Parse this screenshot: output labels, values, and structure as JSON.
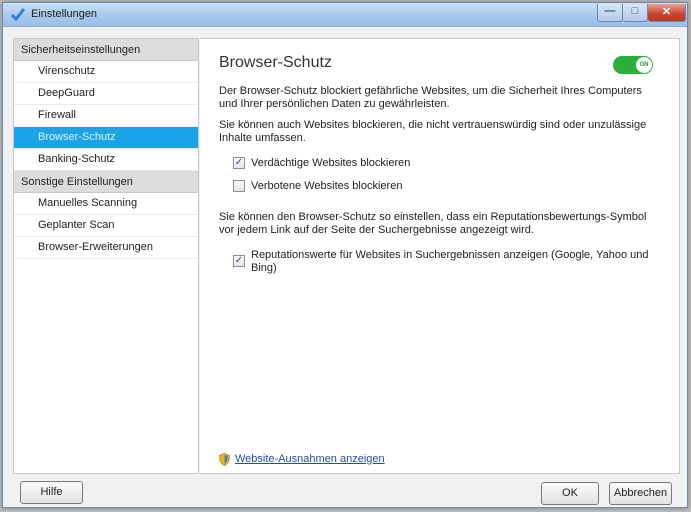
{
  "window": {
    "title": "Einstellungen",
    "controls": {
      "minimize": "—",
      "maximize": "□",
      "close": "✕"
    }
  },
  "sidebar": {
    "sections": [
      {
        "header": "Sicherheitseinstellungen",
        "items": [
          {
            "label": "Virenschutz",
            "selected": false
          },
          {
            "label": "DeepGuard",
            "selected": false
          },
          {
            "label": "Firewall",
            "selected": false
          },
          {
            "label": "Browser-Schutz",
            "selected": true
          },
          {
            "label": "Banking-Schutz",
            "selected": false
          }
        ]
      },
      {
        "header": "Sonstige Einstellungen",
        "items": [
          {
            "label": "Manuelles Scanning",
            "selected": false
          },
          {
            "label": "Geplanter Scan",
            "selected": false
          },
          {
            "label": "Browser-Erweiterungen",
            "selected": false
          }
        ]
      }
    ]
  },
  "main": {
    "title": "Browser-Schutz",
    "toggle": {
      "label": "ON",
      "state": "on",
      "color": "#2cae3b"
    },
    "intro": "Der Browser-Schutz blockiert gefährliche Websites, um die Sicherheit Ihres Computers und Ihrer persönlichen Daten zu gewährleisten.",
    "block_text": "Sie können auch Websites blockieren, die nicht vertrauenswürdig sind oder unzulässige Inhalte umfassen.",
    "options": [
      {
        "label": "Verdächtige Websites blockieren",
        "checked": true
      },
      {
        "label": "Verbotene Websites blockieren",
        "checked": false
      }
    ],
    "reputation_text": "Sie können den Browser-Schutz so einstellen, dass ein Reputationsbewertungs-Symbol vor jedem Link auf der Seite der Suchergebnisse angezeigt wird.",
    "reputation_option": {
      "label": "Reputationswerte für Websites in Suchergebnissen anzeigen (Google, Yahoo und Bing)",
      "checked": true
    },
    "exceptions_link": "Website-Ausnahmen anzeigen"
  },
  "footer": {
    "help": "Hilfe",
    "ok": "OK",
    "cancel": "Abbrechen"
  },
  "colors": {
    "accent": "#1aa3e6",
    "toggle": "#2cae3b",
    "link": "#1f4fa3"
  }
}
